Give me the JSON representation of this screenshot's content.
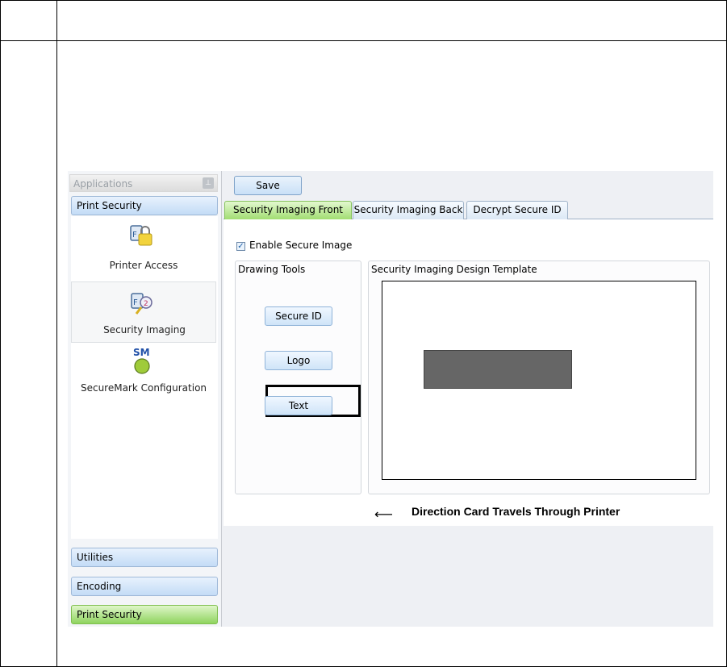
{
  "applications_panel": {
    "header": "Applications",
    "active_group": "Print Security",
    "apps": [
      {
        "label": "Printer Access",
        "icon": "printer-access-lock-icon"
      },
      {
        "label": "Security Imaging",
        "icon": "security-imaging-icon"
      },
      {
        "label": "SecureMark Configuration",
        "icon": "securemark-icon",
        "icon_text": "SM"
      }
    ],
    "bottom_groups": [
      "Utilities",
      "Encoding",
      "Print Security"
    ]
  },
  "toolbar": {
    "save_label": "Save"
  },
  "tabs": [
    {
      "label": "Security Imaging Front",
      "active": true
    },
    {
      "label": "Security Imaging Back",
      "active": false
    },
    {
      "label": "Decrypt Secure ID",
      "active": false
    }
  ],
  "form": {
    "enable_secure_image_label": "Enable Secure Image",
    "enable_secure_image_checked": true
  },
  "drawing_tools": {
    "title": "Drawing Tools",
    "buttons": [
      "Secure ID",
      "Logo",
      "Text"
    ]
  },
  "design_template": {
    "title": "Security Imaging Design Template"
  },
  "caption": "Direction Card Travels Through Printer",
  "colors": {
    "green_accent": "#8fd45f",
    "blue_accent": "#c3dcf6",
    "placeholder_gray": "#666666"
  }
}
